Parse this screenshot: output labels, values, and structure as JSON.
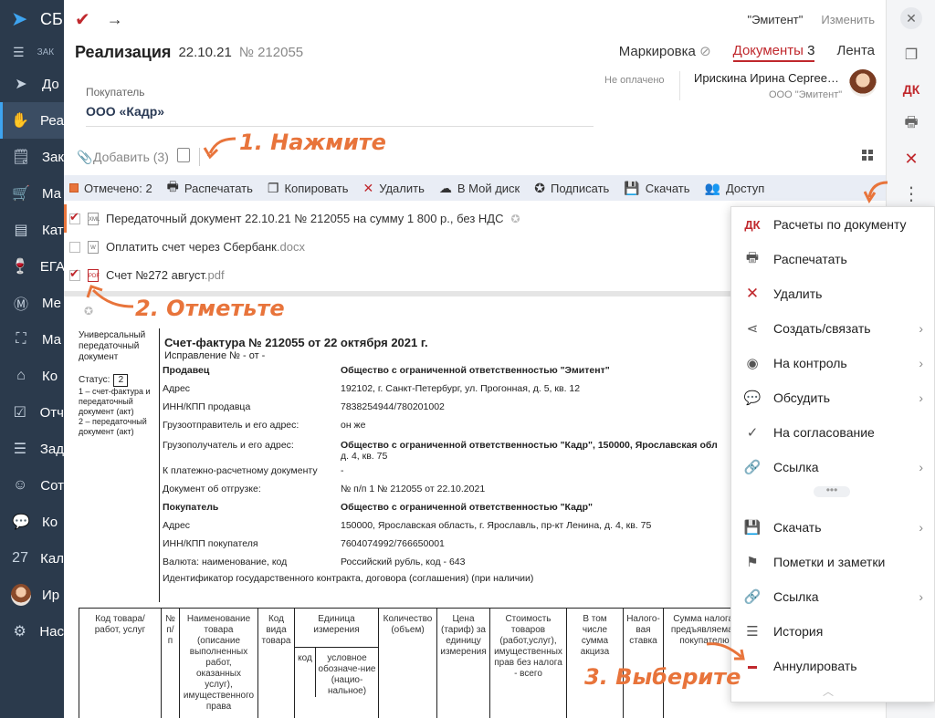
{
  "leftnav": {
    "logo_text": "СБ",
    "menu_text": "ЗАК",
    "items": [
      {
        "label": "До",
        "icon": "send-icon"
      },
      {
        "label": "Реа",
        "icon": "hand-money-icon",
        "active": true
      },
      {
        "label": "Зак",
        "icon": "cart-doc-icon"
      },
      {
        "label": "Ма",
        "icon": "cart-icon"
      },
      {
        "label": "Кат",
        "icon": "catalog-icon"
      },
      {
        "label": "ЕГА",
        "icon": "glass-icon"
      },
      {
        "label": "Ме",
        "icon": "m-badge-icon"
      },
      {
        "label": "Ма",
        "icon": "scan-icon"
      },
      {
        "label": "Ко",
        "icon": "counterparty-icon"
      },
      {
        "label": "Отч",
        "icon": "report-icon"
      },
      {
        "label": "Зад",
        "icon": "tasks-icon"
      },
      {
        "label": "Сот",
        "icon": "staff-icon"
      },
      {
        "label": "Ко",
        "icon": "chat-icon"
      },
      {
        "label": "Кал",
        "icon": "calendar-icon",
        "day": "27"
      },
      {
        "label": "Ир",
        "icon": "avatar"
      },
      {
        "label": "Нас",
        "icon": "gear-icon"
      }
    ]
  },
  "topbar": {
    "org": "\"Эмитент\"",
    "edit": "Изменить"
  },
  "doc": {
    "title": "Реализация",
    "date": "22.10.21",
    "number": "№ 212055",
    "tabs": {
      "marking": "Маркировка",
      "documents": "Документы",
      "documents_count": "3",
      "feed": "Лента"
    },
    "status": "Не оплачено",
    "person": "Ирискина Ирина Сергее…",
    "person_org": "ООО \"Эмитент\"",
    "buyer_label": "Покупатель",
    "buyer_value": "ООО «Кадр»",
    "add_label": "Добавить (3)"
  },
  "toolbar": {
    "marked": "Отмечено: 2",
    "print": "Распечатать",
    "copy": "Копировать",
    "delete": "Удалить",
    "mydisk": "В Мой диск",
    "sign": "Подписать",
    "download": "Скачать",
    "access": "Доступ"
  },
  "files": [
    {
      "name": "Передаточный документ 22.10.21 № 212055 на сумму 1 800 р., без НДС",
      "ext": "",
      "checked": true,
      "type": "UPD"
    },
    {
      "name": "Оплатить счет через Сбербанк",
      "ext": ".docx",
      "checked": false,
      "type": "W"
    },
    {
      "name": "Счет №272 август",
      "ext": ".pdf",
      "checked": true,
      "type": "PDF"
    }
  ],
  "annotations": {
    "step1": "1. Нажмите",
    "step2": "2. Отметьте",
    "step3": "3. Выберите"
  },
  "preview": {
    "side_title": "Универсальный передаточный документ",
    "status_label": "Статус:",
    "status_value": "2",
    "status_note1": "1 – счет-фактура и передаточный документ (акт)",
    "status_note2": "2 – передаточный документ (акт)",
    "title": "Счет-фактура № 212055 от 22 октября 2021 г.",
    "subtitle": "Исправление № - от -",
    "rows": [
      {
        "k": "Продавец",
        "v": "Общество с ограниченной ответственностью \"Эмитент\"",
        "bold": true
      },
      {
        "k": "Адрес",
        "v": "192102, г. Санкт-Петербург, ул. Прогонная, д. 5, кв. 12"
      },
      {
        "k": "ИНН/КПП продавца",
        "v": "7838254944/780201002"
      },
      {
        "k": "Грузоотправитель и его адрес:",
        "v": "он же"
      },
      {
        "k": "Грузополучатель и его адрес:",
        "v": "Общество с ограниченной ответственностью \"Кадр\", 150000, Ярославская обл",
        "v2": "д. 4, кв. 75"
      },
      {
        "k": "К платежно-расчетному документу",
        "v": "-"
      },
      {
        "k": "Документ об отгрузке:",
        "v": "№ п/п 1 № 212055 от 22.10.2021"
      },
      {
        "k": "Покупатель",
        "v": "Общество с ограниченной ответственностью \"Кадр\"",
        "bold": true
      },
      {
        "k": "Адрес",
        "v": "150000, Ярославская область, г. Ярославль, пр-кт Ленина, д. 4, кв. 75"
      },
      {
        "k": "ИНН/КПП покупателя",
        "v": "7604074992/766650001"
      },
      {
        "k": "Валюта: наименование, код",
        "v": "Российский рубль, код - 643"
      },
      {
        "k": "Идентификатор государственного контракта, договора (соглашения) (при наличии)",
        "v": ""
      }
    ],
    "columns": [
      "Код товара/ работ, услуг",
      "№ п/п",
      "Наименование товара (описание выполненных работ, оказанных услуг), имущественного права",
      "Код вида товара",
      "Единица измерения",
      "Количество (объем)",
      "Цена (тариф) за единицу измерения",
      "Стоимость товаров (работ,услуг), имущественных прав без налога - всего",
      "В том числе сумма акциза",
      "Налого-вая ставка",
      "Сумма налога, предъявляемая покупателю"
    ],
    "unit_sub": [
      "код",
      "условное обозначе-ние (нацио-нальное)"
    ]
  },
  "rightbar": {
    "dk": "ДК"
  },
  "context_menu": {
    "items": [
      {
        "label": "Расчеты по документу",
        "icon": "dk-icon",
        "chevron": false
      },
      {
        "label": "Распечатать",
        "icon": "printer-icon",
        "chevron": false
      },
      {
        "label": "Удалить",
        "icon": "delete-icon",
        "chevron": false
      },
      {
        "label": "Создать/связать",
        "icon": "share-icon",
        "chevron": true
      },
      {
        "label": "На контроль",
        "icon": "eye-icon",
        "chevron": true
      },
      {
        "label": "Обсудить",
        "icon": "chat-icon",
        "chevron": true
      },
      {
        "label": "На согласование",
        "icon": "approve-icon",
        "chevron": false
      },
      {
        "label": "Ссылка",
        "icon": "link-icon",
        "chevron": true
      },
      {
        "label": "Скачать",
        "icon": "save-icon",
        "chevron": true
      },
      {
        "label": "Пометки и заметки",
        "icon": "flag-icon",
        "chevron": false
      },
      {
        "label": "Ссылка",
        "icon": "link-icon",
        "chevron": true
      },
      {
        "label": "История",
        "icon": "history-icon",
        "chevron": false
      },
      {
        "label": "Аннулировать",
        "icon": "annul-icon",
        "chevron": false
      }
    ]
  },
  "colors": {
    "accent": "#c0282d",
    "annotation": "#e8743b",
    "nav": "#2b3a4c"
  }
}
